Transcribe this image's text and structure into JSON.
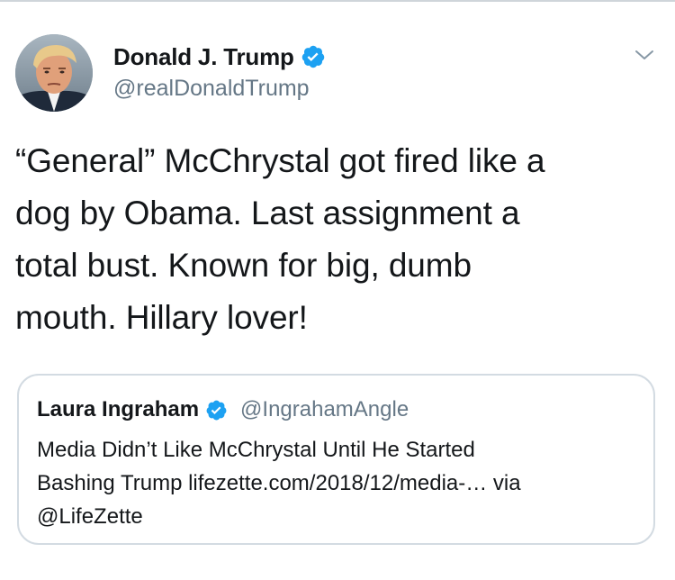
{
  "tweet": {
    "author_name": "Donald J. Trump",
    "author_handle": "@realDonaldTrump",
    "verified": true,
    "text": "“General” McChrystal got fired like a\ndog by Obama. Last assignment a\ntotal bust. Known for big, dumb\nmouth. Hillary lover!"
  },
  "quoted_tweet": {
    "author_name": "Laura Ingraham",
    "author_handle": "@IngrahamAngle",
    "verified": true,
    "text": "Media Didn’t Like McChrystal Until He Started\nBashing Trump lifezette.com/2018/12/media-… via\n@LifeZette"
  },
  "icons": {
    "verified": "verified-badge-icon",
    "menu": "chevron-down-icon"
  },
  "colors": {
    "verified_blue": "#1da1f2",
    "text": "#14171a",
    "secondary_text": "#657786",
    "border": "#d3dbe2"
  }
}
